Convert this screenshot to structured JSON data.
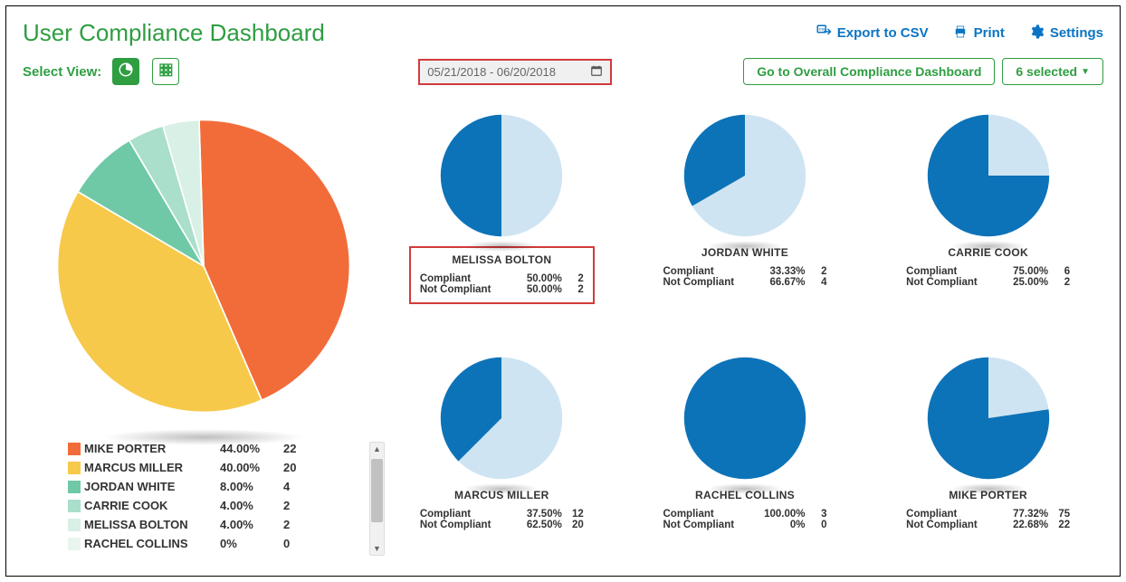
{
  "title": "User Compliance Dashboard",
  "header_actions": {
    "export": "Export to CSV",
    "print": "Print",
    "settings": "Settings"
  },
  "controls": {
    "select_view_label": "Select View:",
    "date_range": "05/21/2018 - 06/20/2018",
    "overall_btn": "Go to Overall Compliance Dashboard",
    "selected_btn": "6 selected"
  },
  "colors": {
    "orange": "#f26c3a",
    "yellow": "#f7c94a",
    "teal": "#6fc9a7",
    "teal_lt": "#a9dfcb",
    "mint": "#d8f0e6",
    "mint_lt": "#e8f6ef",
    "blue": "#0d73b8",
    "blue_lt": "#cfe4f2"
  },
  "labels": {
    "compliant": "Compliant",
    "not_compliant": "Not Compliant"
  },
  "chart_data": {
    "overview_pie": {
      "type": "pie",
      "title": "",
      "series": [
        {
          "name": "MIKE PORTER",
          "color": "orange",
          "value": 22,
          "pct": "44.00%"
        },
        {
          "name": "MARCUS MILLER",
          "color": "yellow",
          "value": 20,
          "pct": "40.00%"
        },
        {
          "name": "JORDAN WHITE",
          "color": "teal",
          "value": 4,
          "pct": "8.00%"
        },
        {
          "name": "CARRIE COOK",
          "color": "teal_lt",
          "value": 2,
          "pct": "4.00%"
        },
        {
          "name": "MELISSA BOLTON",
          "color": "mint",
          "value": 2,
          "pct": "4.00%"
        },
        {
          "name": "RACHEL COLLINS",
          "color": "mint_lt",
          "value": 0,
          "pct": "0%"
        }
      ]
    },
    "users": [
      {
        "name": "MELISSA BOLTON",
        "highlighted": true,
        "compliant_pct": "50.00%",
        "compliant_cnt": 2,
        "noncompliant_pct": "50.00%",
        "noncompliant_cnt": 2,
        "pie": {
          "compliant": 50,
          "noncompliant": 50
        }
      },
      {
        "name": "JORDAN WHITE",
        "highlighted": false,
        "compliant_pct": "33.33%",
        "compliant_cnt": 2,
        "noncompliant_pct": "66.67%",
        "noncompliant_cnt": 4,
        "pie": {
          "compliant": 33.33,
          "noncompliant": 66.67
        }
      },
      {
        "name": "CARRIE COOK",
        "highlighted": false,
        "compliant_pct": "75.00%",
        "compliant_cnt": 6,
        "noncompliant_pct": "25.00%",
        "noncompliant_cnt": 2,
        "pie": {
          "compliant": 75,
          "noncompliant": 25
        }
      },
      {
        "name": "MARCUS MILLER",
        "highlighted": false,
        "compliant_pct": "37.50%",
        "compliant_cnt": 12,
        "noncompliant_pct": "62.50%",
        "noncompliant_cnt": 20,
        "pie": {
          "compliant": 37.5,
          "noncompliant": 62.5
        }
      },
      {
        "name": "RACHEL COLLINS",
        "highlighted": false,
        "compliant_pct": "100.00%",
        "compliant_cnt": 3,
        "noncompliant_pct": "0%",
        "noncompliant_cnt": 0,
        "pie": {
          "compliant": 100,
          "noncompliant": 0
        }
      },
      {
        "name": "MIKE PORTER",
        "highlighted": false,
        "compliant_pct": "77.32%",
        "compliant_cnt": 75,
        "noncompliant_pct": "22.68%",
        "noncompliant_cnt": 22,
        "pie": {
          "compliant": 77.32,
          "noncompliant": 22.68
        }
      }
    ]
  }
}
